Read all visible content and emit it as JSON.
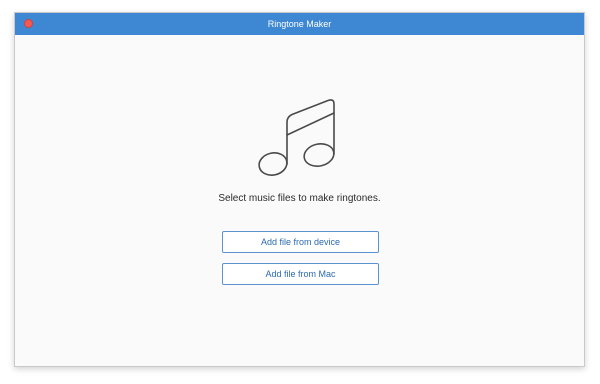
{
  "window": {
    "title": "Ringtone Maker"
  },
  "main": {
    "icon": "music-note-icon",
    "prompt": "Select music files to make ringtones.",
    "buttons": {
      "add_from_device": "Add file from device",
      "add_from_mac": "Add file from Mac"
    }
  },
  "colors": {
    "titlebar": "#3d87d3",
    "close": "#f05a55",
    "button_border": "#5b92cf",
    "button_text": "#2c6ab3"
  }
}
